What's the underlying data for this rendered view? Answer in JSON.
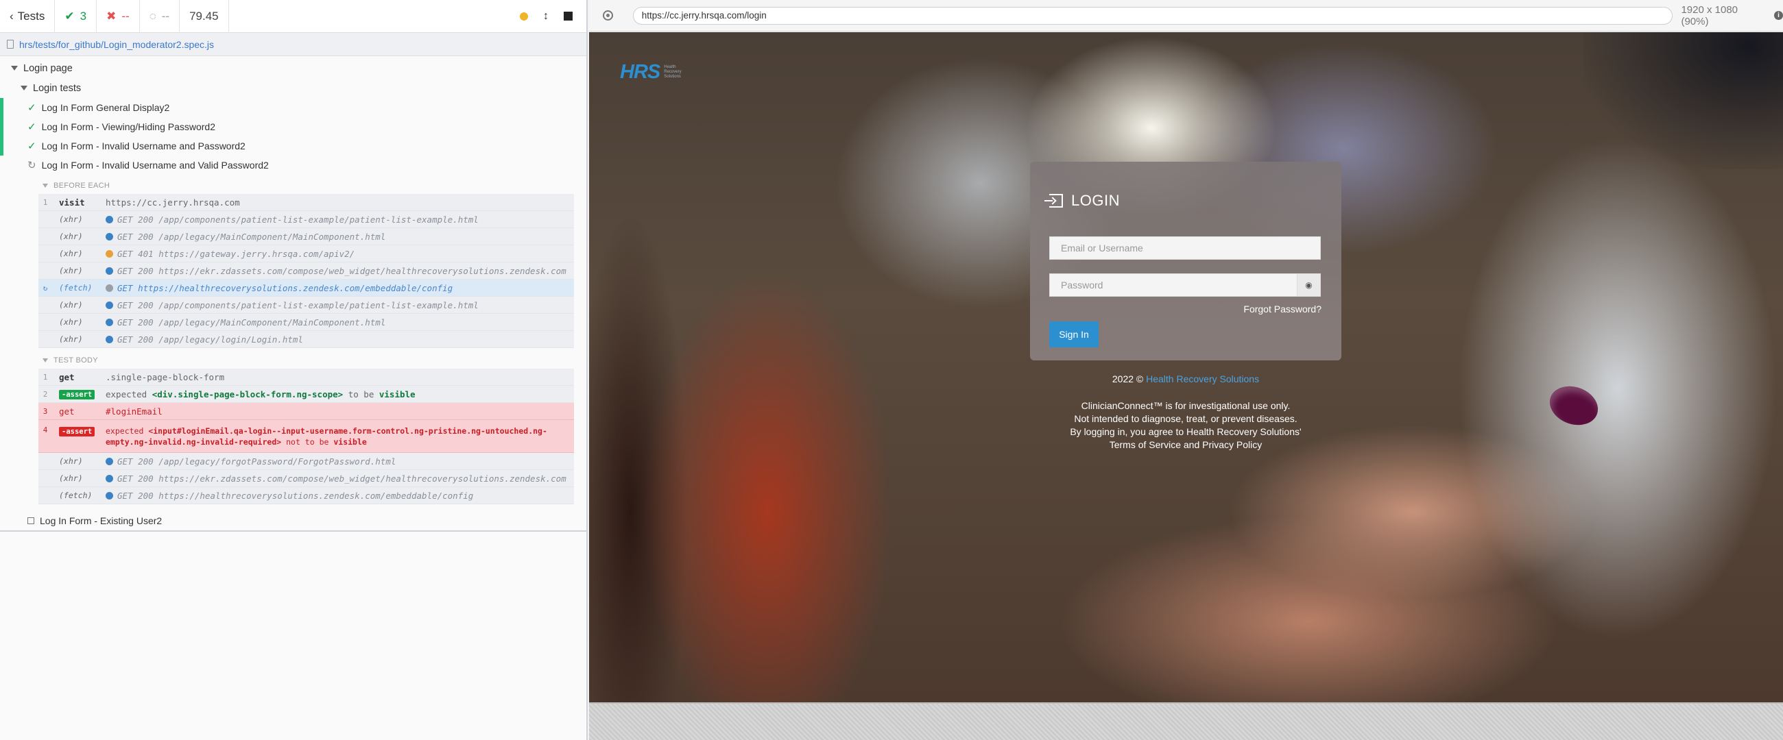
{
  "reporter": {
    "tests_label": "Tests",
    "passed": "3",
    "failed": "--",
    "pending": "--",
    "duration": "79.45",
    "spec_path": "hrs/tests/for_github/Login_moderator2.spec.js",
    "suite": "Login page",
    "subsuite": "Login tests",
    "tests": [
      {
        "title": "Log In Form General Display2",
        "state": "passed"
      },
      {
        "title": "Log In Form - Viewing/Hiding Password2",
        "state": "passed"
      },
      {
        "title": "Log In Form - Invalid Username and Password2",
        "state": "passed"
      },
      {
        "title": "Log In Form - Invalid Username and Valid Password2",
        "state": "running"
      }
    ],
    "before_each_label": "BEFORE EACH",
    "test_body_label": "TEST BODY",
    "before_each": [
      {
        "num": "1",
        "name": "visit",
        "msg": "https://cc.jerry.hrsqa.com"
      },
      {
        "num": "",
        "name": "(xhr)",
        "status": "blue",
        "msg": "GET 200 /app/components/patient-list-example/patient-list-example.html"
      },
      {
        "num": "",
        "name": "(xhr)",
        "status": "blue",
        "msg": "GET 200 /app/legacy/MainComponent/MainComponent.html"
      },
      {
        "num": "",
        "name": "(xhr)",
        "status": "orange",
        "msg": "GET 401 https://gateway.jerry.hrsqa.com/apiv2/"
      },
      {
        "num": "",
        "name": "(xhr)",
        "status": "blue",
        "msg": "GET 200 https://ekr.zdassets.com/compose/web_widget/healthrecoverysolutions.zendesk.com"
      },
      {
        "num": "",
        "name": "(fetch)",
        "status": "gray",
        "msg": "GET https://healthrecoverysolutions.zendesk.com/embeddable/config",
        "active": true
      },
      {
        "num": "",
        "name": "(xhr)",
        "status": "blue",
        "msg": "GET 200 /app/components/patient-list-example/patient-list-example.html"
      },
      {
        "num": "",
        "name": "(xhr)",
        "status": "blue",
        "msg": "GET 200 /app/legacy/MainComponent/MainComponent.html"
      },
      {
        "num": "",
        "name": "(xhr)",
        "status": "blue",
        "msg": "GET 200 /app/legacy/login/Login.html"
      }
    ],
    "test_body": {
      "c1": {
        "num": "1",
        "name": "get",
        "msg": ".single-page-block-form"
      },
      "c2": {
        "num": "2",
        "name": "-assert",
        "pre": "expected ",
        "subject": "<div.single-page-block-form.ng-scope>",
        "mid": " to be ",
        "post": "visible"
      },
      "c3": {
        "num": "3",
        "name": "get",
        "msg": "#loginEmail"
      },
      "c4": {
        "num": "4",
        "name": "-assert",
        "pre": "expected ",
        "subject": "<input#loginEmail.qa-login--input-username.form-control.ng-pristine.ng-untouched.ng-empty.ng-invalid.ng-invalid-required>",
        "mid": " not to be ",
        "post": "visible"
      },
      "xhr": [
        {
          "name": "(xhr)",
          "msg": "GET 200 /app/legacy/forgotPassword/ForgotPassword.html"
        },
        {
          "name": "(xhr)",
          "msg": "GET 200 https://ekr.zdassets.com/compose/web_widget/healthrecoverysolutions.zendesk.com"
        },
        {
          "name": "(fetch)",
          "msg": "GET 200 https://healthrecoverysolutions.zendesk.com/embeddable/config"
        }
      ]
    },
    "last_test": "Log In Form - Existing User2"
  },
  "aut": {
    "url": "https://cc.jerry.hrsqa.com/login",
    "viewport": "1920 x 1080",
    "zoom": "(90%)"
  },
  "app": {
    "logo_text": "HRS",
    "logo_sub": "Health Recovery Solutions",
    "login_title": "LOGIN",
    "email_placeholder": "Email or Username",
    "password_placeholder": "Password",
    "forgot": "Forgot Password?",
    "signin": "Sign In",
    "copyright_pre": "2022 ©",
    "copyright_link": "Health Recovery Solutions",
    "disclaimer1": "ClinicianConnect™ is for investigational use only.",
    "disclaimer2": "Not intended to diagnose, treat, or prevent diseases.",
    "disclaimer3": "By logging in, you agree to Health Recovery Solutions'",
    "terms": "Terms of Service and Privacy Policy"
  },
  "colors": {
    "blue": "#3b82c4",
    "orange": "#e8a13a",
    "gray": "#9aa0a8",
    "accent": "#2b8fd0"
  }
}
